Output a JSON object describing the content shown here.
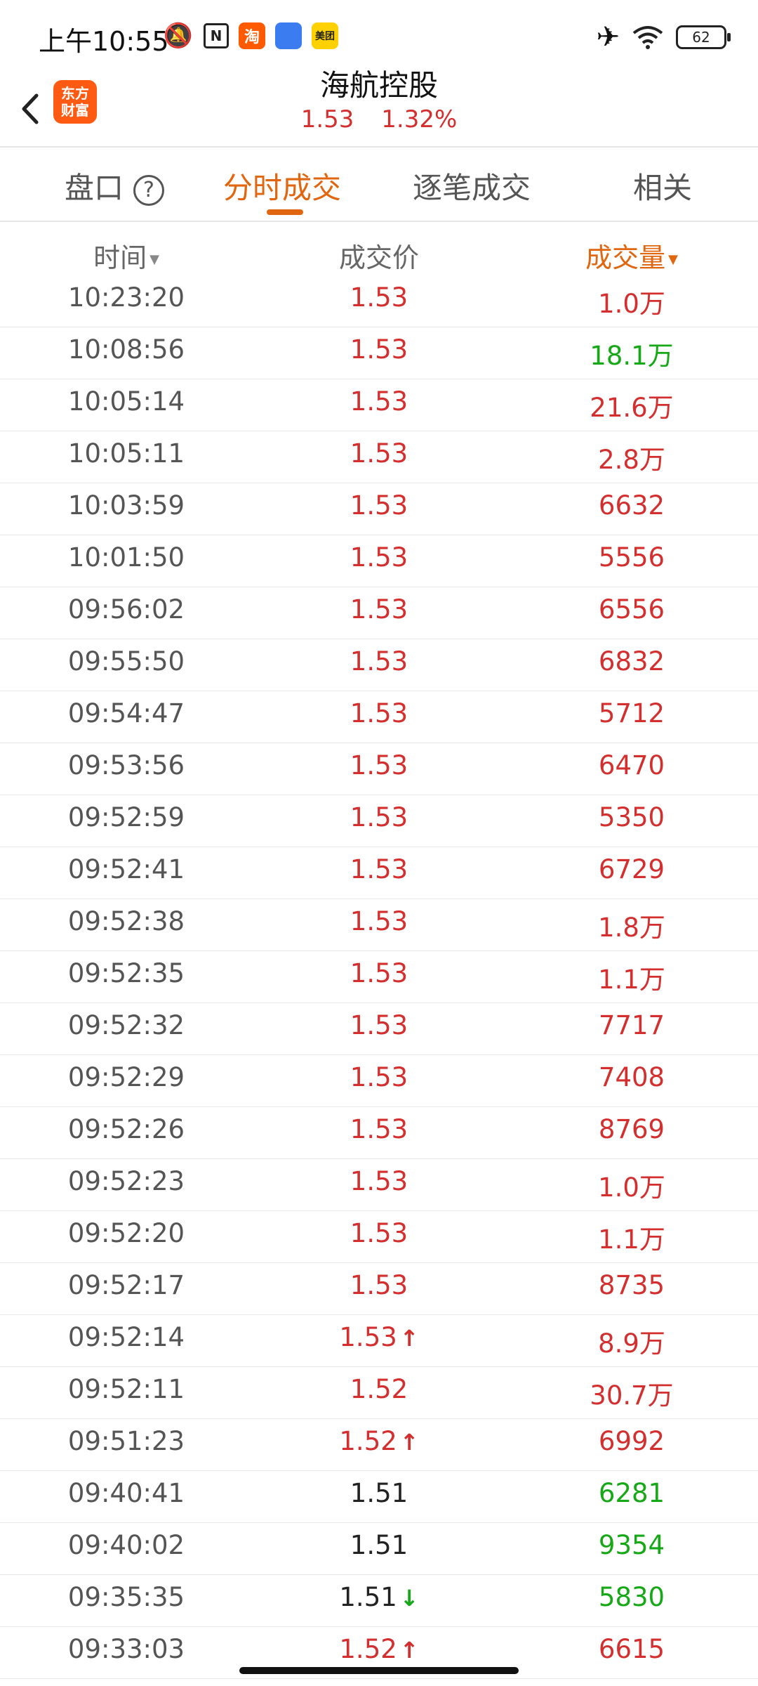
{
  "status_bar": {
    "time": "上午10:55",
    "battery": "62",
    "taobao_glyph": "淘",
    "meituan_glyph": "美团",
    "nfc_glyph": "N"
  },
  "header": {
    "stock_name": "海航控股",
    "price": "1.53",
    "change_pct": "1.32%",
    "logo_text_line1": "东方",
    "logo_text_line2": "财富"
  },
  "tabs": [
    {
      "label": "盘口",
      "active": false
    },
    {
      "label": "分时成交",
      "active": true
    },
    {
      "label": "逐笔成交",
      "active": false
    },
    {
      "label": "相关",
      "active": false
    }
  ],
  "help_glyph": "?",
  "columns": {
    "time": "时间",
    "price": "成交价",
    "volume": "成交量"
  },
  "rows": [
    {
      "time": "10:23:20",
      "price": "1.53",
      "price_color": "red",
      "arrow": "",
      "volume": "1.0万",
      "vol_color": "red"
    },
    {
      "time": "10:08:56",
      "price": "1.53",
      "price_color": "red",
      "arrow": "",
      "volume": "18.1万",
      "vol_color": "green"
    },
    {
      "time": "10:05:14",
      "price": "1.53",
      "price_color": "red",
      "arrow": "",
      "volume": "21.6万",
      "vol_color": "red"
    },
    {
      "time": "10:05:11",
      "price": "1.53",
      "price_color": "red",
      "arrow": "",
      "volume": "2.8万",
      "vol_color": "red"
    },
    {
      "time": "10:03:59",
      "price": "1.53",
      "price_color": "red",
      "arrow": "",
      "volume": "6632",
      "vol_color": "red"
    },
    {
      "time": "10:01:50",
      "price": "1.53",
      "price_color": "red",
      "arrow": "",
      "volume": "5556",
      "vol_color": "red"
    },
    {
      "time": "09:56:02",
      "price": "1.53",
      "price_color": "red",
      "arrow": "",
      "volume": "6556",
      "vol_color": "red"
    },
    {
      "time": "09:55:50",
      "price": "1.53",
      "price_color": "red",
      "arrow": "",
      "volume": "6832",
      "vol_color": "red"
    },
    {
      "time": "09:54:47",
      "price": "1.53",
      "price_color": "red",
      "arrow": "",
      "volume": "5712",
      "vol_color": "red"
    },
    {
      "time": "09:53:56",
      "price": "1.53",
      "price_color": "red",
      "arrow": "",
      "volume": "6470",
      "vol_color": "red"
    },
    {
      "time": "09:52:59",
      "price": "1.53",
      "price_color": "red",
      "arrow": "",
      "volume": "5350",
      "vol_color": "red"
    },
    {
      "time": "09:52:41",
      "price": "1.53",
      "price_color": "red",
      "arrow": "",
      "volume": "6729",
      "vol_color": "red"
    },
    {
      "time": "09:52:38",
      "price": "1.53",
      "price_color": "red",
      "arrow": "",
      "volume": "1.8万",
      "vol_color": "red"
    },
    {
      "time": "09:52:35",
      "price": "1.53",
      "price_color": "red",
      "arrow": "",
      "volume": "1.1万",
      "vol_color": "red"
    },
    {
      "time": "09:52:32",
      "price": "1.53",
      "price_color": "red",
      "arrow": "",
      "volume": "7717",
      "vol_color": "red"
    },
    {
      "time": "09:52:29",
      "price": "1.53",
      "price_color": "red",
      "arrow": "",
      "volume": "7408",
      "vol_color": "red"
    },
    {
      "time": "09:52:26",
      "price": "1.53",
      "price_color": "red",
      "arrow": "",
      "volume": "8769",
      "vol_color": "red"
    },
    {
      "time": "09:52:23",
      "price": "1.53",
      "price_color": "red",
      "arrow": "",
      "volume": "1.0万",
      "vol_color": "red"
    },
    {
      "time": "09:52:20",
      "price": "1.53",
      "price_color": "red",
      "arrow": "",
      "volume": "1.1万",
      "vol_color": "red"
    },
    {
      "time": "09:52:17",
      "price": "1.53",
      "price_color": "red",
      "arrow": "",
      "volume": "8735",
      "vol_color": "red"
    },
    {
      "time": "09:52:14",
      "price": "1.53",
      "price_color": "red",
      "arrow": "up",
      "volume": "8.9万",
      "vol_color": "red"
    },
    {
      "time": "09:52:11",
      "price": "1.52",
      "price_color": "red",
      "arrow": "",
      "volume": "30.7万",
      "vol_color": "red"
    },
    {
      "time": "09:51:23",
      "price": "1.52",
      "price_color": "red",
      "arrow": "up",
      "volume": "6992",
      "vol_color": "red"
    },
    {
      "time": "09:40:41",
      "price": "1.51",
      "price_color": "black",
      "arrow": "",
      "volume": "6281",
      "vol_color": "green"
    },
    {
      "time": "09:40:02",
      "price": "1.51",
      "price_color": "black",
      "arrow": "",
      "volume": "9354",
      "vol_color": "green"
    },
    {
      "time": "09:35:35",
      "price": "1.51",
      "price_color": "black",
      "arrow": "down",
      "volume": "5830",
      "vol_color": "green"
    },
    {
      "time": "09:33:03",
      "price": "1.52",
      "price_color": "red",
      "arrow": "up",
      "volume": "6615",
      "vol_color": "red"
    }
  ],
  "arrows": {
    "up": "↑",
    "down": "↓"
  },
  "colors": {
    "red": "#d32f2f",
    "green": "#17a817",
    "accent": "#e0660f"
  }
}
